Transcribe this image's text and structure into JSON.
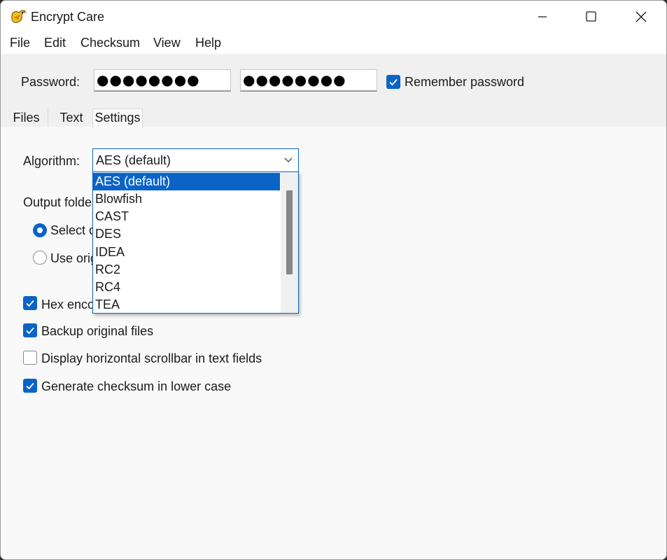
{
  "window": {
    "title": "Encrypt Care"
  },
  "menu": [
    "File",
    "Edit",
    "Checksum",
    "View",
    "Help"
  ],
  "password": {
    "label": "Password:",
    "field1_value": "●●●●●●●●",
    "field2_value": "●●●●●●●●",
    "remember_label": "Remember password",
    "remember_checked": true
  },
  "tabs": [
    "Files",
    "Text",
    "Settings"
  ],
  "active_tab": "Settings",
  "settings": {
    "algorithm_label": "Algorithm:",
    "algorithm_value": "AES (default)",
    "algorithm_options": [
      "AES (default)",
      "Blowfish",
      "CAST",
      "DES",
      "IDEA",
      "RC2",
      "RC4",
      "TEA"
    ],
    "output_folder_label": "Output folde",
    "radio_select_label": "Select o",
    "radio_use_label": "Use orig",
    "hex_label": "Hex enco",
    "hex_checked": true,
    "backup_label": "Backup original files",
    "backup_checked": true,
    "hscroll_label": "Display horizontal scrollbar in text fields",
    "hscroll_checked": false,
    "lowercase_label": "Generate checksum in lower case",
    "lowercase_checked": true
  },
  "colors": {
    "accent": "#0a64c8",
    "panel": "#f0f0f0",
    "content": "#f9f9f9"
  }
}
